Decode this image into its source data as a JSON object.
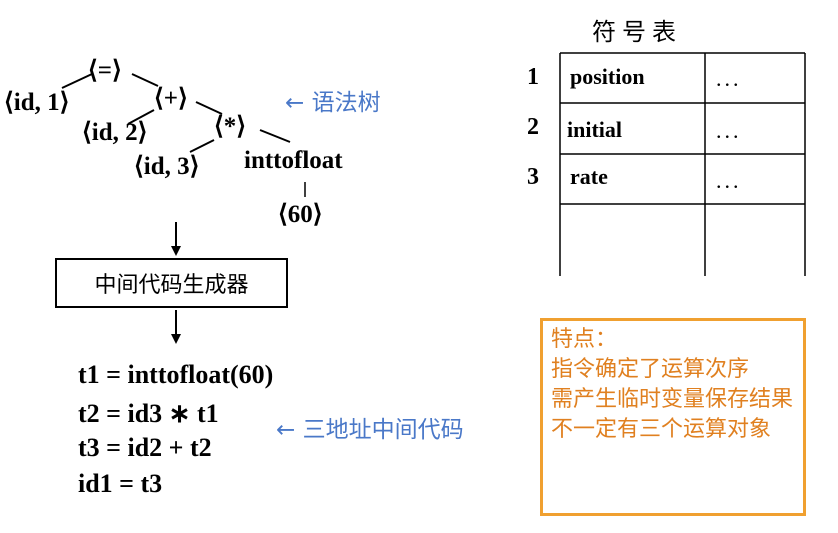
{
  "tree": {
    "nodes": [
      "⟨=⟩",
      "⟨id, 1⟩",
      "⟨+⟩",
      "⟨id, 2⟩",
      "⟨*⟩",
      "⟨id, 3⟩",
      "inttofloat",
      "⟨60⟩"
    ],
    "label": "← 语法树"
  },
  "generator": {
    "label": "中间代码生成器"
  },
  "code": {
    "lines": [
      "t1 = inttofloat(60)",
      "t2 = id3 ∗ t1",
      "t3 = id2 + t2",
      "id1 = t3"
    ],
    "label": "← 三地址中间代码"
  },
  "symbol_table": {
    "title": "符号表",
    "rows": [
      {
        "num": "1",
        "name": "position",
        "info": "..."
      },
      {
        "num": "2",
        "name": "initial",
        "info": "..."
      },
      {
        "num": "3",
        "name": "rate",
        "info": "..."
      },
      {
        "num": "",
        "name": "",
        "info": ""
      }
    ]
  },
  "note": {
    "heading": "特点：",
    "lines": [
      "指令确定了运算次序",
      "需产生临时变量保存结果",
      "不一定有三个运算对象"
    ]
  }
}
